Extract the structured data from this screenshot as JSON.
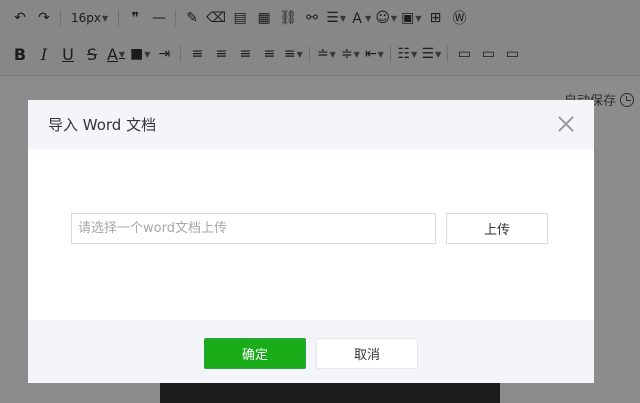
{
  "editor": {
    "toolbar": {
      "font_size": "16px",
      "row1_icons": [
        "undo-icon",
        "redo-icon",
        "blockquote-icon",
        "horizontal-rule-icon",
        "format-painter-icon",
        "clear-format-icon",
        "paste-text-icon",
        "document-icon",
        "link-icon",
        "unlink-icon",
        "line-height-icon",
        "letter-spacing-icon",
        "emoji-icon",
        "image-icon",
        "template-icon",
        "word-import-icon"
      ],
      "row2_icons": [
        "bold-icon",
        "italic-icon",
        "underline-icon",
        "strikethrough-icon",
        "font-color-icon",
        "background-color-icon",
        "indent-icon",
        "align-left-icon",
        "align-center-icon",
        "align-right-icon",
        "justify-icon",
        "justify-all-icon",
        "paragraph-spacing-icon",
        "line-spacing-icon",
        "text-indent-icon",
        "ordered-list-icon",
        "unordered-list-icon",
        "table-icon",
        "table-edit-icon",
        "table-delete-icon"
      ]
    },
    "autosave_label": "自动保存"
  },
  "modal": {
    "title": "导入 Word 文档",
    "file_input_placeholder": "请选择一个word文档上传",
    "upload_label": "上传",
    "confirm_label": "确定",
    "cancel_label": "取消"
  },
  "colors": {
    "confirm_green": "#1aad19",
    "header_bg": "#f4f5f9"
  }
}
